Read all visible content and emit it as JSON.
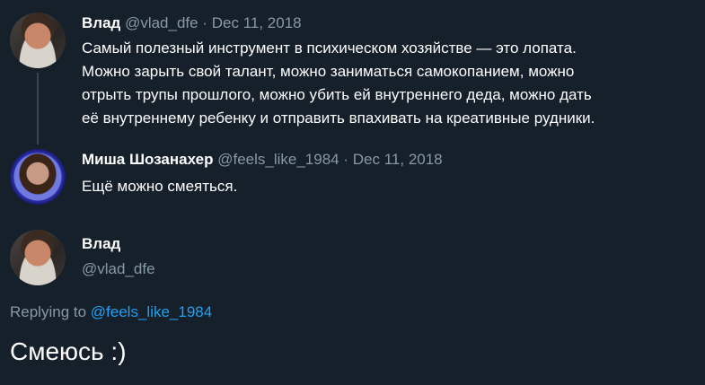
{
  "tweet1": {
    "name": "Влад",
    "handle": "@vlad_dfe",
    "sep": "·",
    "date": "Dec 11, 2018",
    "lines": [
      "Самый полезный инструмент в психическом хозяйстве — это лопата.",
      "Можно зарыть свой талант, можно заниматься самокопанием, можно",
      "отрыть трупы прошлого, можно убить ей внутреннего деда, можно дать",
      "её внутреннему ребенку и отправить впахивать на креативные рудники."
    ]
  },
  "tweet2": {
    "name": "Миша Шозанахер",
    "handle": "@feels_like_1984",
    "sep": "·",
    "date": "Dec 11, 2018",
    "text": "Ещё можно смеяться."
  },
  "reply": {
    "name": "Влад",
    "handle": "@vlad_dfe",
    "replying_prefix": "Replying to",
    "replying_handle": "@feels_like_1984",
    "text": "Смеюсь :)"
  },
  "colors": {
    "background": "#15202b",
    "muted": "#8899a6",
    "link": "#1da1f2"
  }
}
